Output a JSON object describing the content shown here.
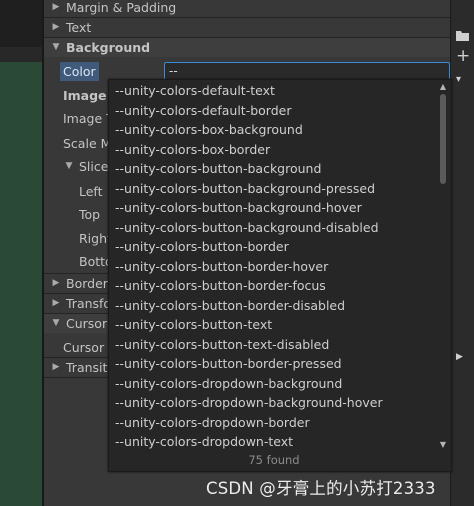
{
  "inspector": {
    "rows": [
      {
        "label": "Margin & Padding",
        "arrow": "▶"
      },
      {
        "label": "Text",
        "arrow": "▶"
      },
      {
        "label": "Background",
        "arrow": "▼"
      },
      {
        "label": "Color"
      },
      {
        "label": "Image"
      },
      {
        "label": "Image T"
      },
      {
        "label": "Scale M"
      },
      {
        "label": "Slice",
        "arrow": "▼"
      },
      {
        "label": "Left"
      },
      {
        "label": "Top"
      },
      {
        "label": "Right"
      },
      {
        "label": "Botto"
      },
      {
        "label": "Border",
        "arrow": "▶"
      },
      {
        "label": "Transfo",
        "arrow": "▶"
      },
      {
        "label": "Cursor",
        "arrow": "▼"
      },
      {
        "label": "Cursor I"
      },
      {
        "label": "Transiti",
        "arrow": "▶"
      }
    ],
    "color_value": "--"
  },
  "dropdown": {
    "options": [
      "--unity-colors-default-text",
      "--unity-colors-default-border",
      "--unity-colors-box-background",
      "--unity-colors-box-border",
      "--unity-colors-button-background",
      "--unity-colors-button-background-pressed",
      "--unity-colors-button-background-hover",
      "--unity-colors-button-background-disabled",
      "--unity-colors-button-border",
      "--unity-colors-button-border-hover",
      "--unity-colors-button-border-focus",
      "--unity-colors-button-border-disabled",
      "--unity-colors-button-text",
      "--unity-colors-button-text-disabled",
      "--unity-colors-button-border-pressed",
      "--unity-colors-dropdown-background",
      "--unity-colors-dropdown-background-hover",
      "--unity-colors-dropdown-border",
      "--unity-colors-dropdown-text"
    ],
    "found_text": "75 found"
  },
  "watermark": "CSDN @牙膏上的小苏打2333",
  "colors": {
    "accent": "#3b8ad8",
    "label_highlight": "#3f5a7a",
    "panel": "#383838",
    "dropdown_bg": "#262626",
    "scene": "#2a4a37"
  }
}
